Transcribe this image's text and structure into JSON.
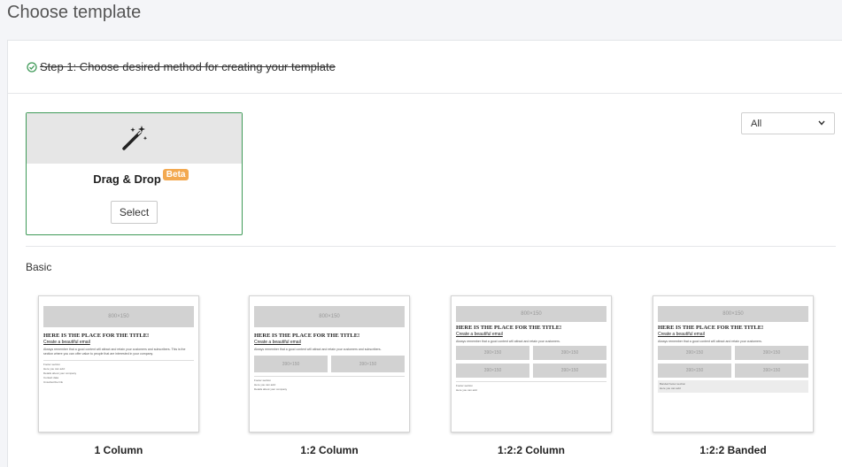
{
  "page": {
    "title": "Choose template"
  },
  "step": {
    "text": "Step 1: Choose desired method for creating your template",
    "icon": "check-circle-icon",
    "color": "#3f9a58"
  },
  "drag_drop": {
    "icon": "magic-wand-icon",
    "title": "Drag & Drop",
    "badge": "Beta",
    "select_label": "Select",
    "accent": "#3f9a58",
    "badge_color": "#f3a950"
  },
  "filter": {
    "selected": "All",
    "icon": "chevron-down-icon"
  },
  "section": {
    "label": "Basic"
  },
  "templates": [
    {
      "name": "1 Column"
    },
    {
      "name": "1:2 Column"
    },
    {
      "name": "1:2:2 Column"
    },
    {
      "name": "1:2:2 Banded"
    }
  ]
}
